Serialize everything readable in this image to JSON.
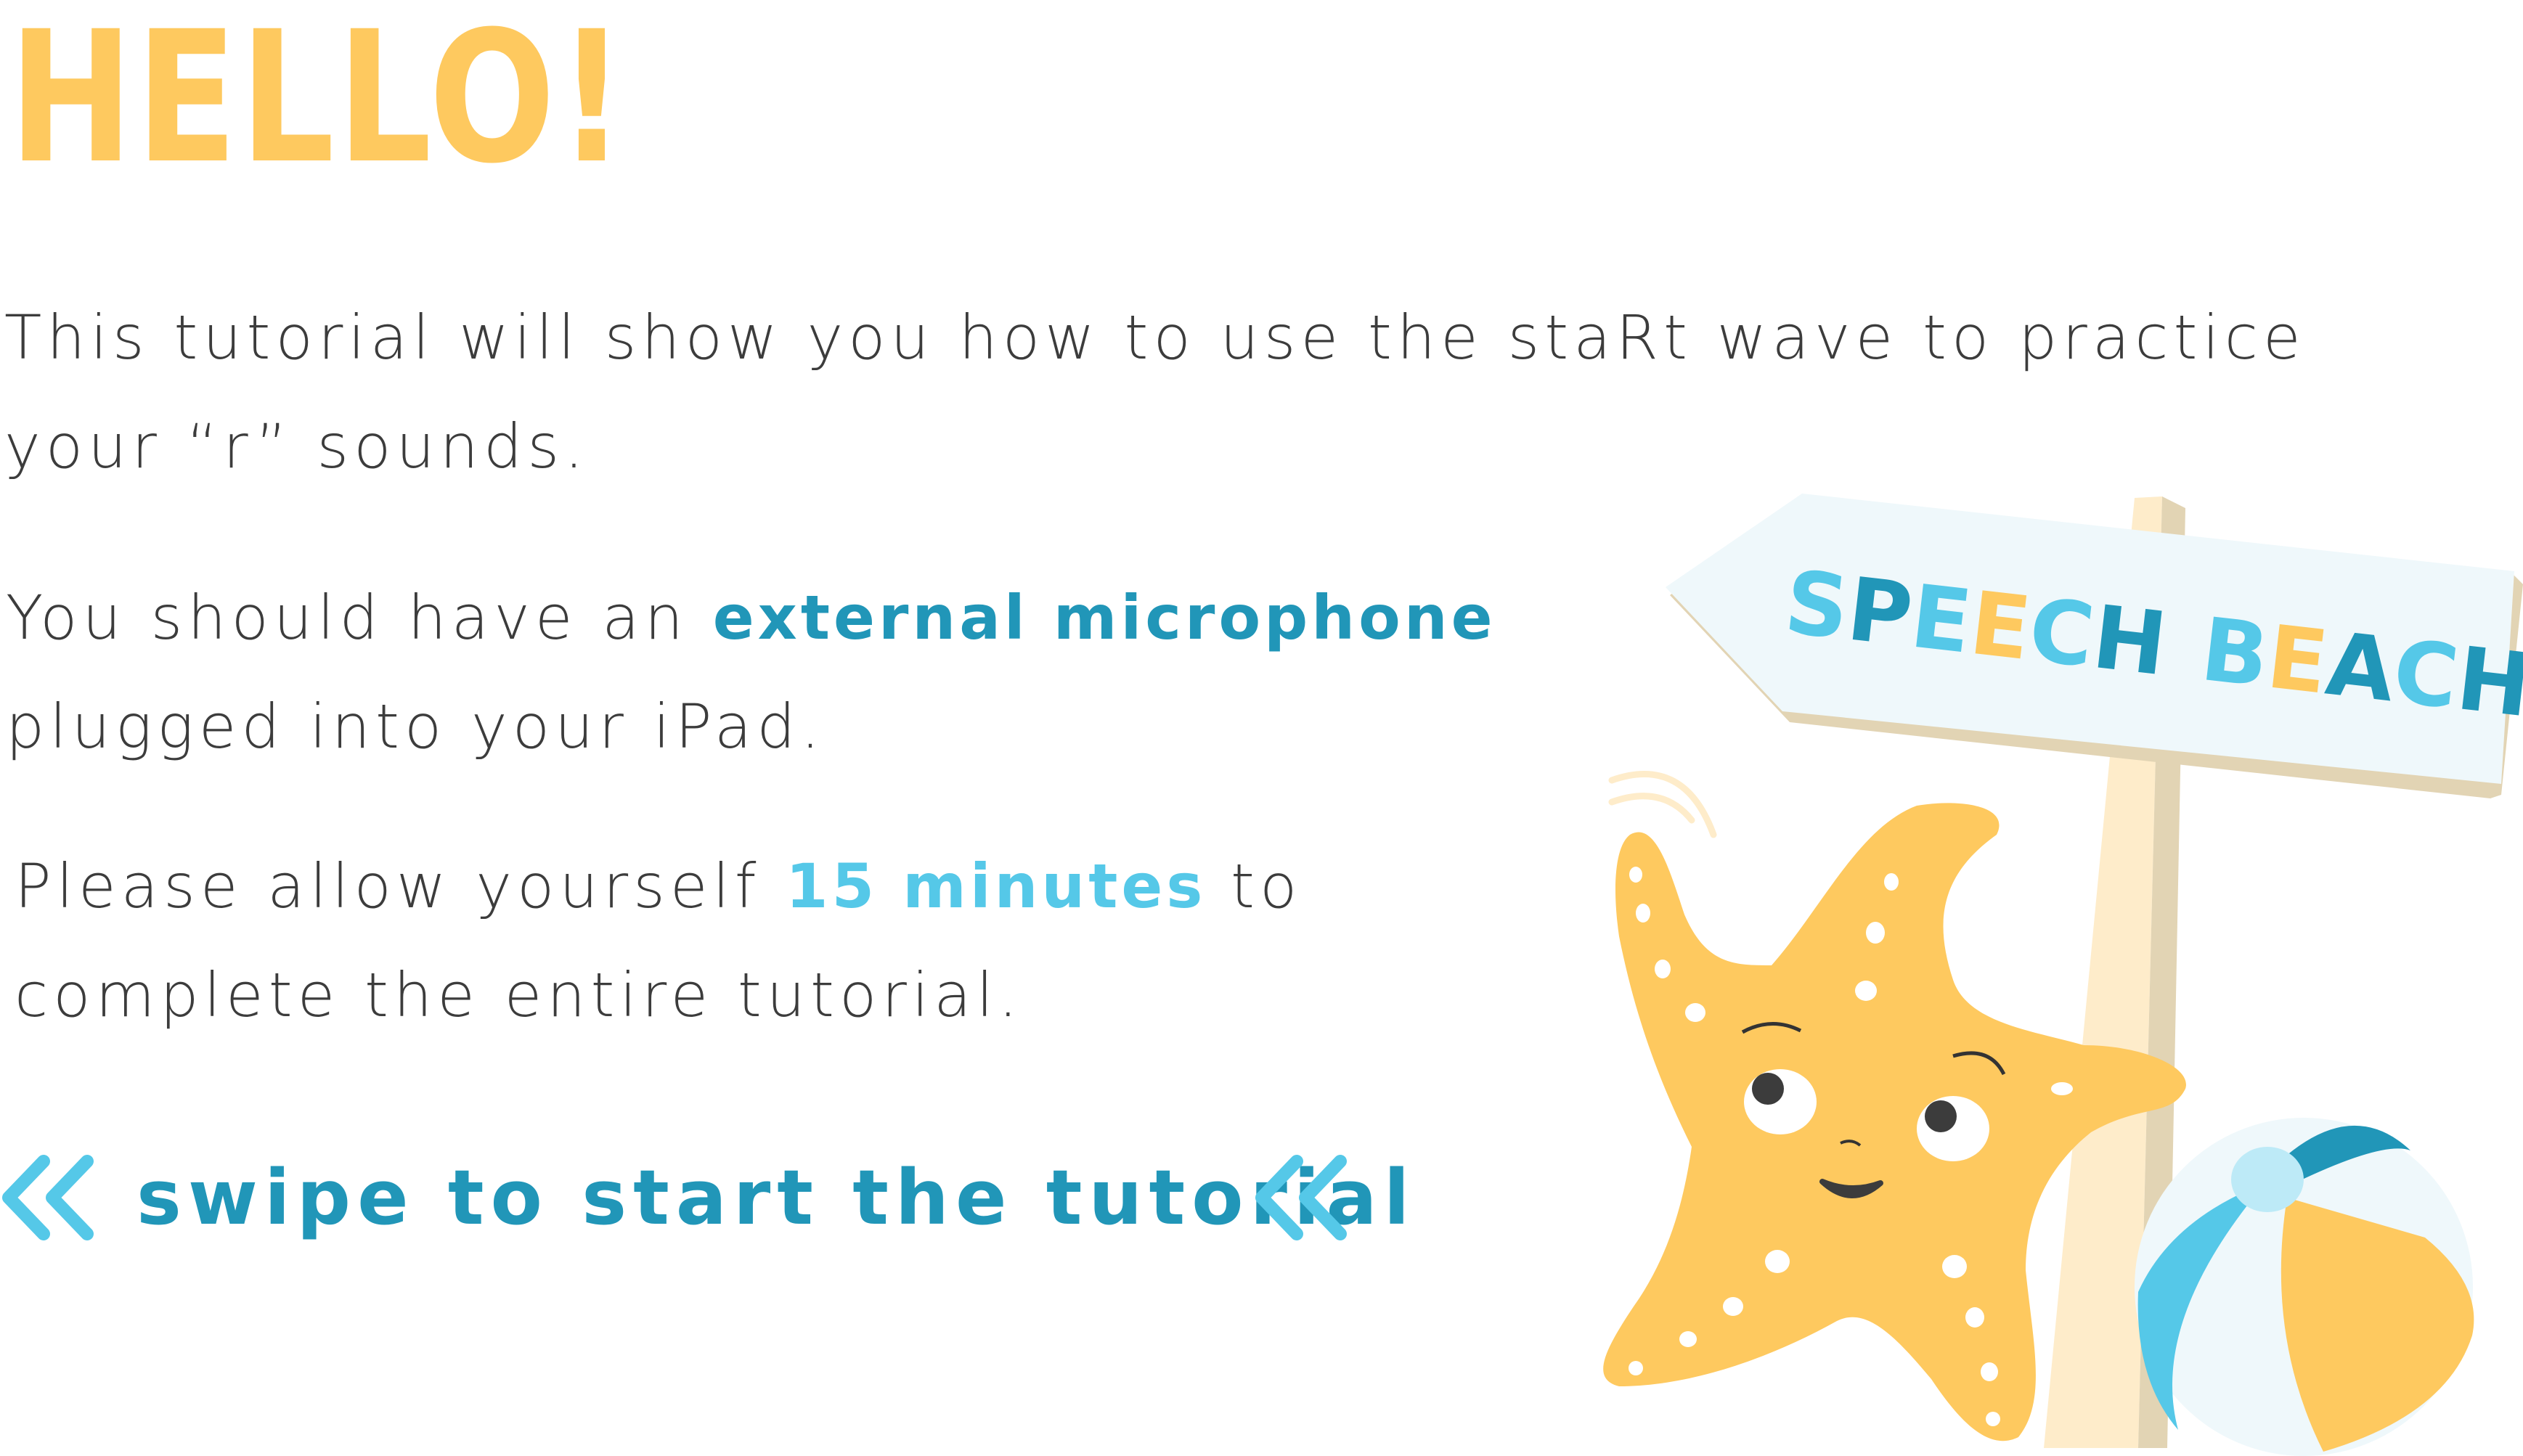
{
  "heading": "HELLO!",
  "intro": {
    "line1": "This tutorial will show you how to use the staRt wave to practice",
    "line2": "your “r” sounds."
  },
  "microphone": {
    "prefix": "You should have an ",
    "highlight": "external microphone",
    "line2": "plugged into your iPad."
  },
  "time": {
    "prefix": "Please allow yourself ",
    "highlight": "15 minutes",
    "suffix": " to",
    "line2": "complete the entire tutorial."
  },
  "swipe": {
    "label": "swipe to start the tutorial",
    "icon": "double-chevron-left-icon"
  },
  "sign": {
    "word1": [
      "S",
      "P",
      "E",
      "E",
      "C",
      "H"
    ],
    "word2": [
      "B",
      "E",
      "A",
      "C",
      "H"
    ],
    "logo_text": "SPEECH BEACH"
  },
  "colors": {
    "yellow": "#fec95f",
    "teal": "#2196b8",
    "light_blue": "#55c8e8",
    "text": "#3c3c3c"
  }
}
